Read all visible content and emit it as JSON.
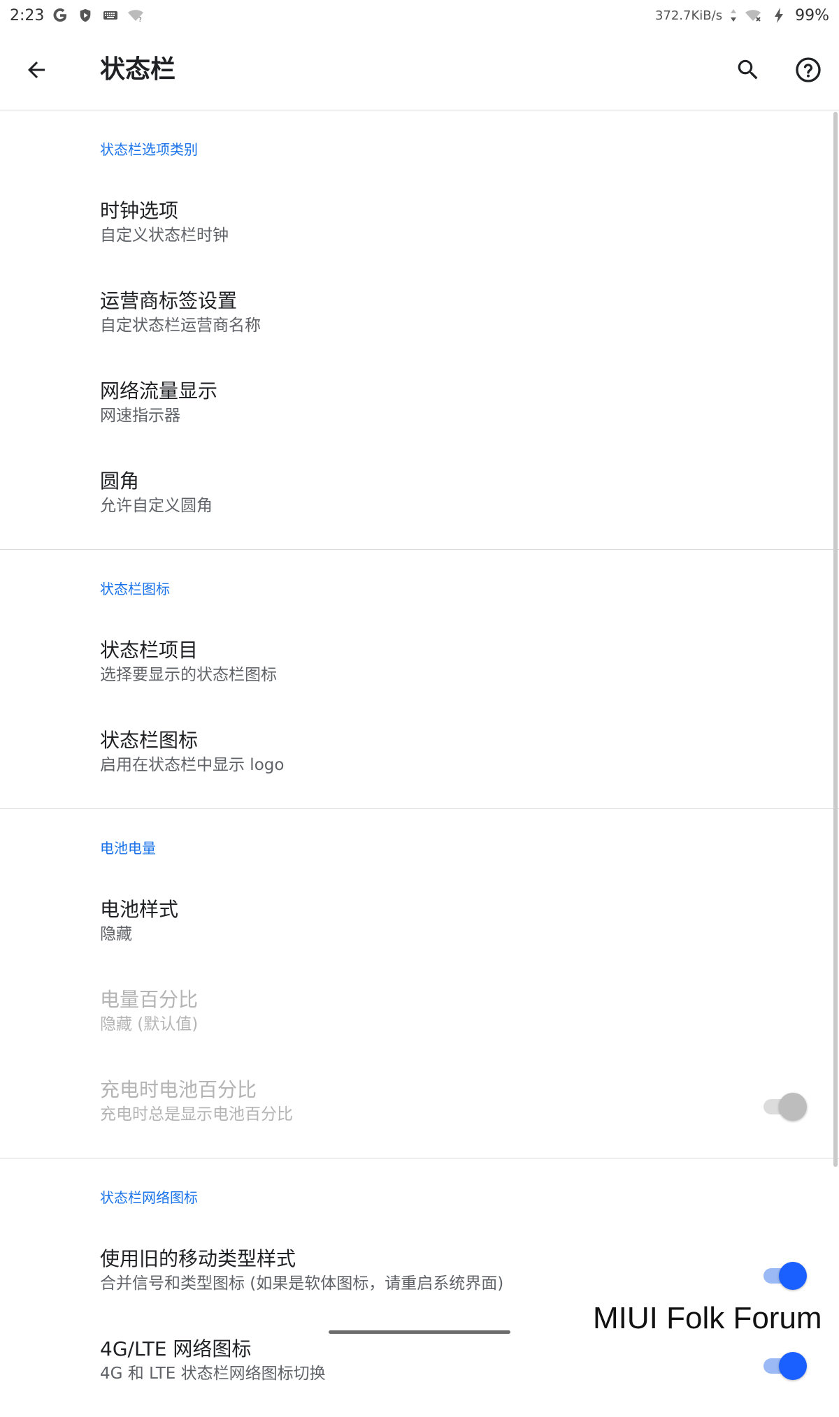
{
  "status_bar": {
    "time": "2:23",
    "speed": "372.7KiB/s",
    "battery": "99%",
    "icons": [
      "google-icon",
      "shield-play-icon",
      "keyboard-icon",
      "wifi-question-icon",
      "data-arrows-icon",
      "wifi-x-icon",
      "charging-bolt-icon"
    ]
  },
  "app_bar": {
    "title": "状态栏",
    "back_icon": "arrow-back-icon",
    "search_icon": "search-icon",
    "help_icon": "help-circle-icon"
  },
  "sections": [
    {
      "header": "状态栏选项类别",
      "items": [
        {
          "title": "时钟选项",
          "summary": "自定义状态栏时钟"
        },
        {
          "title": "运营商标签设置",
          "summary": "自定状态栏运营商名称"
        },
        {
          "title": "网络流量显示",
          "summary": "网速指示器"
        },
        {
          "title": "圆角",
          "summary": "允许自定义圆角"
        }
      ]
    },
    {
      "header": "状态栏图标",
      "items": [
        {
          "title": "状态栏项目",
          "summary": "选择要显示的状态栏图标"
        },
        {
          "title": "状态栏图标",
          "summary": "启用在状态栏中显示 logo"
        }
      ]
    },
    {
      "header": "电池电量",
      "items": [
        {
          "title": "电池样式",
          "summary": "隐藏"
        },
        {
          "title": "电量百分比",
          "summary": "隐藏 (默认值)"
        },
        {
          "title": "充电时电池百分比",
          "summary": "充电时总是显示电池百分比",
          "switch": "off"
        }
      ]
    },
    {
      "header": "状态栏网络图标",
      "items": [
        {
          "title": "使用旧的移动类型样式",
          "summary": "合并信号和类型图标 (如果是软体图标，请重启系统界面)",
          "switch": "on"
        },
        {
          "title": "4G/LTE 网络图标",
          "summary": "4G 和 LTE 状态栏网络图标切换",
          "switch": "on"
        }
      ]
    }
  ],
  "watermark": "MIUI Folk Forum",
  "colors": {
    "accent": "#1a73e8",
    "switch_on": "#1a5fff",
    "switch_on_track": "#9ab9f5",
    "switch_off_thumb": "#bdbdbd",
    "switch_off_track": "#dcdcdc",
    "disabled_text": "#b4b4b4"
  }
}
